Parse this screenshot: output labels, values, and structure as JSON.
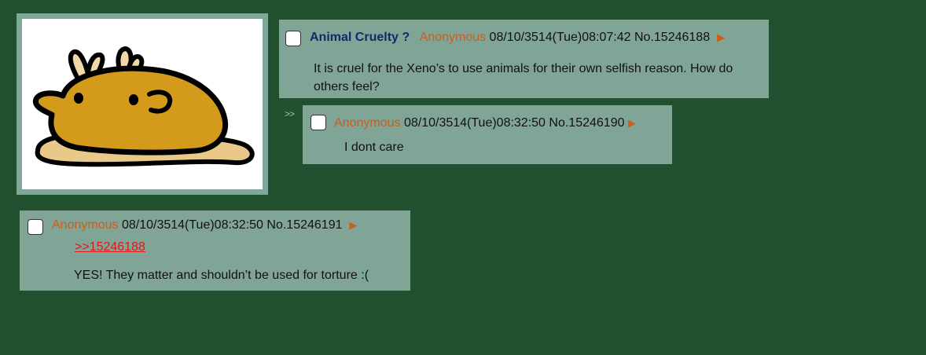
{
  "thumbnail": {
    "alt_icon": "creature-image"
  },
  "op": {
    "subject": "Animal Cruelty ?",
    "name": "Anonymous",
    "datetime": "08/10/3514(Tue)08:07:42",
    "number": "No.15246188",
    "arrow": "▶",
    "body_line1": "It is cruel for the Xeno’s to use animals for their own selfish reason. How do",
    "body_line2": "others feel?"
  },
  "reply_marker": ">>",
  "reply1": {
    "name": "Anonymous",
    "datetime": "08/10/3514(Tue)08:32:50",
    "number": "No.15246190",
    "arrow": "▶",
    "body": "I dont care"
  },
  "reply2": {
    "name": "Anonymous",
    "datetime": "08/10/3514(Tue)08:32:50",
    "number": "No.15246191",
    "arrow": "▶",
    "quote": ">>15246188",
    "body": "YES! They matter and shouldn’t be used for torture :("
  },
  "colors": {
    "background": "#21502e",
    "post_bg": "#80a495",
    "name": "#cc5e1c",
    "subject": "#0f2c6a",
    "quotelink": "#e01717"
  }
}
